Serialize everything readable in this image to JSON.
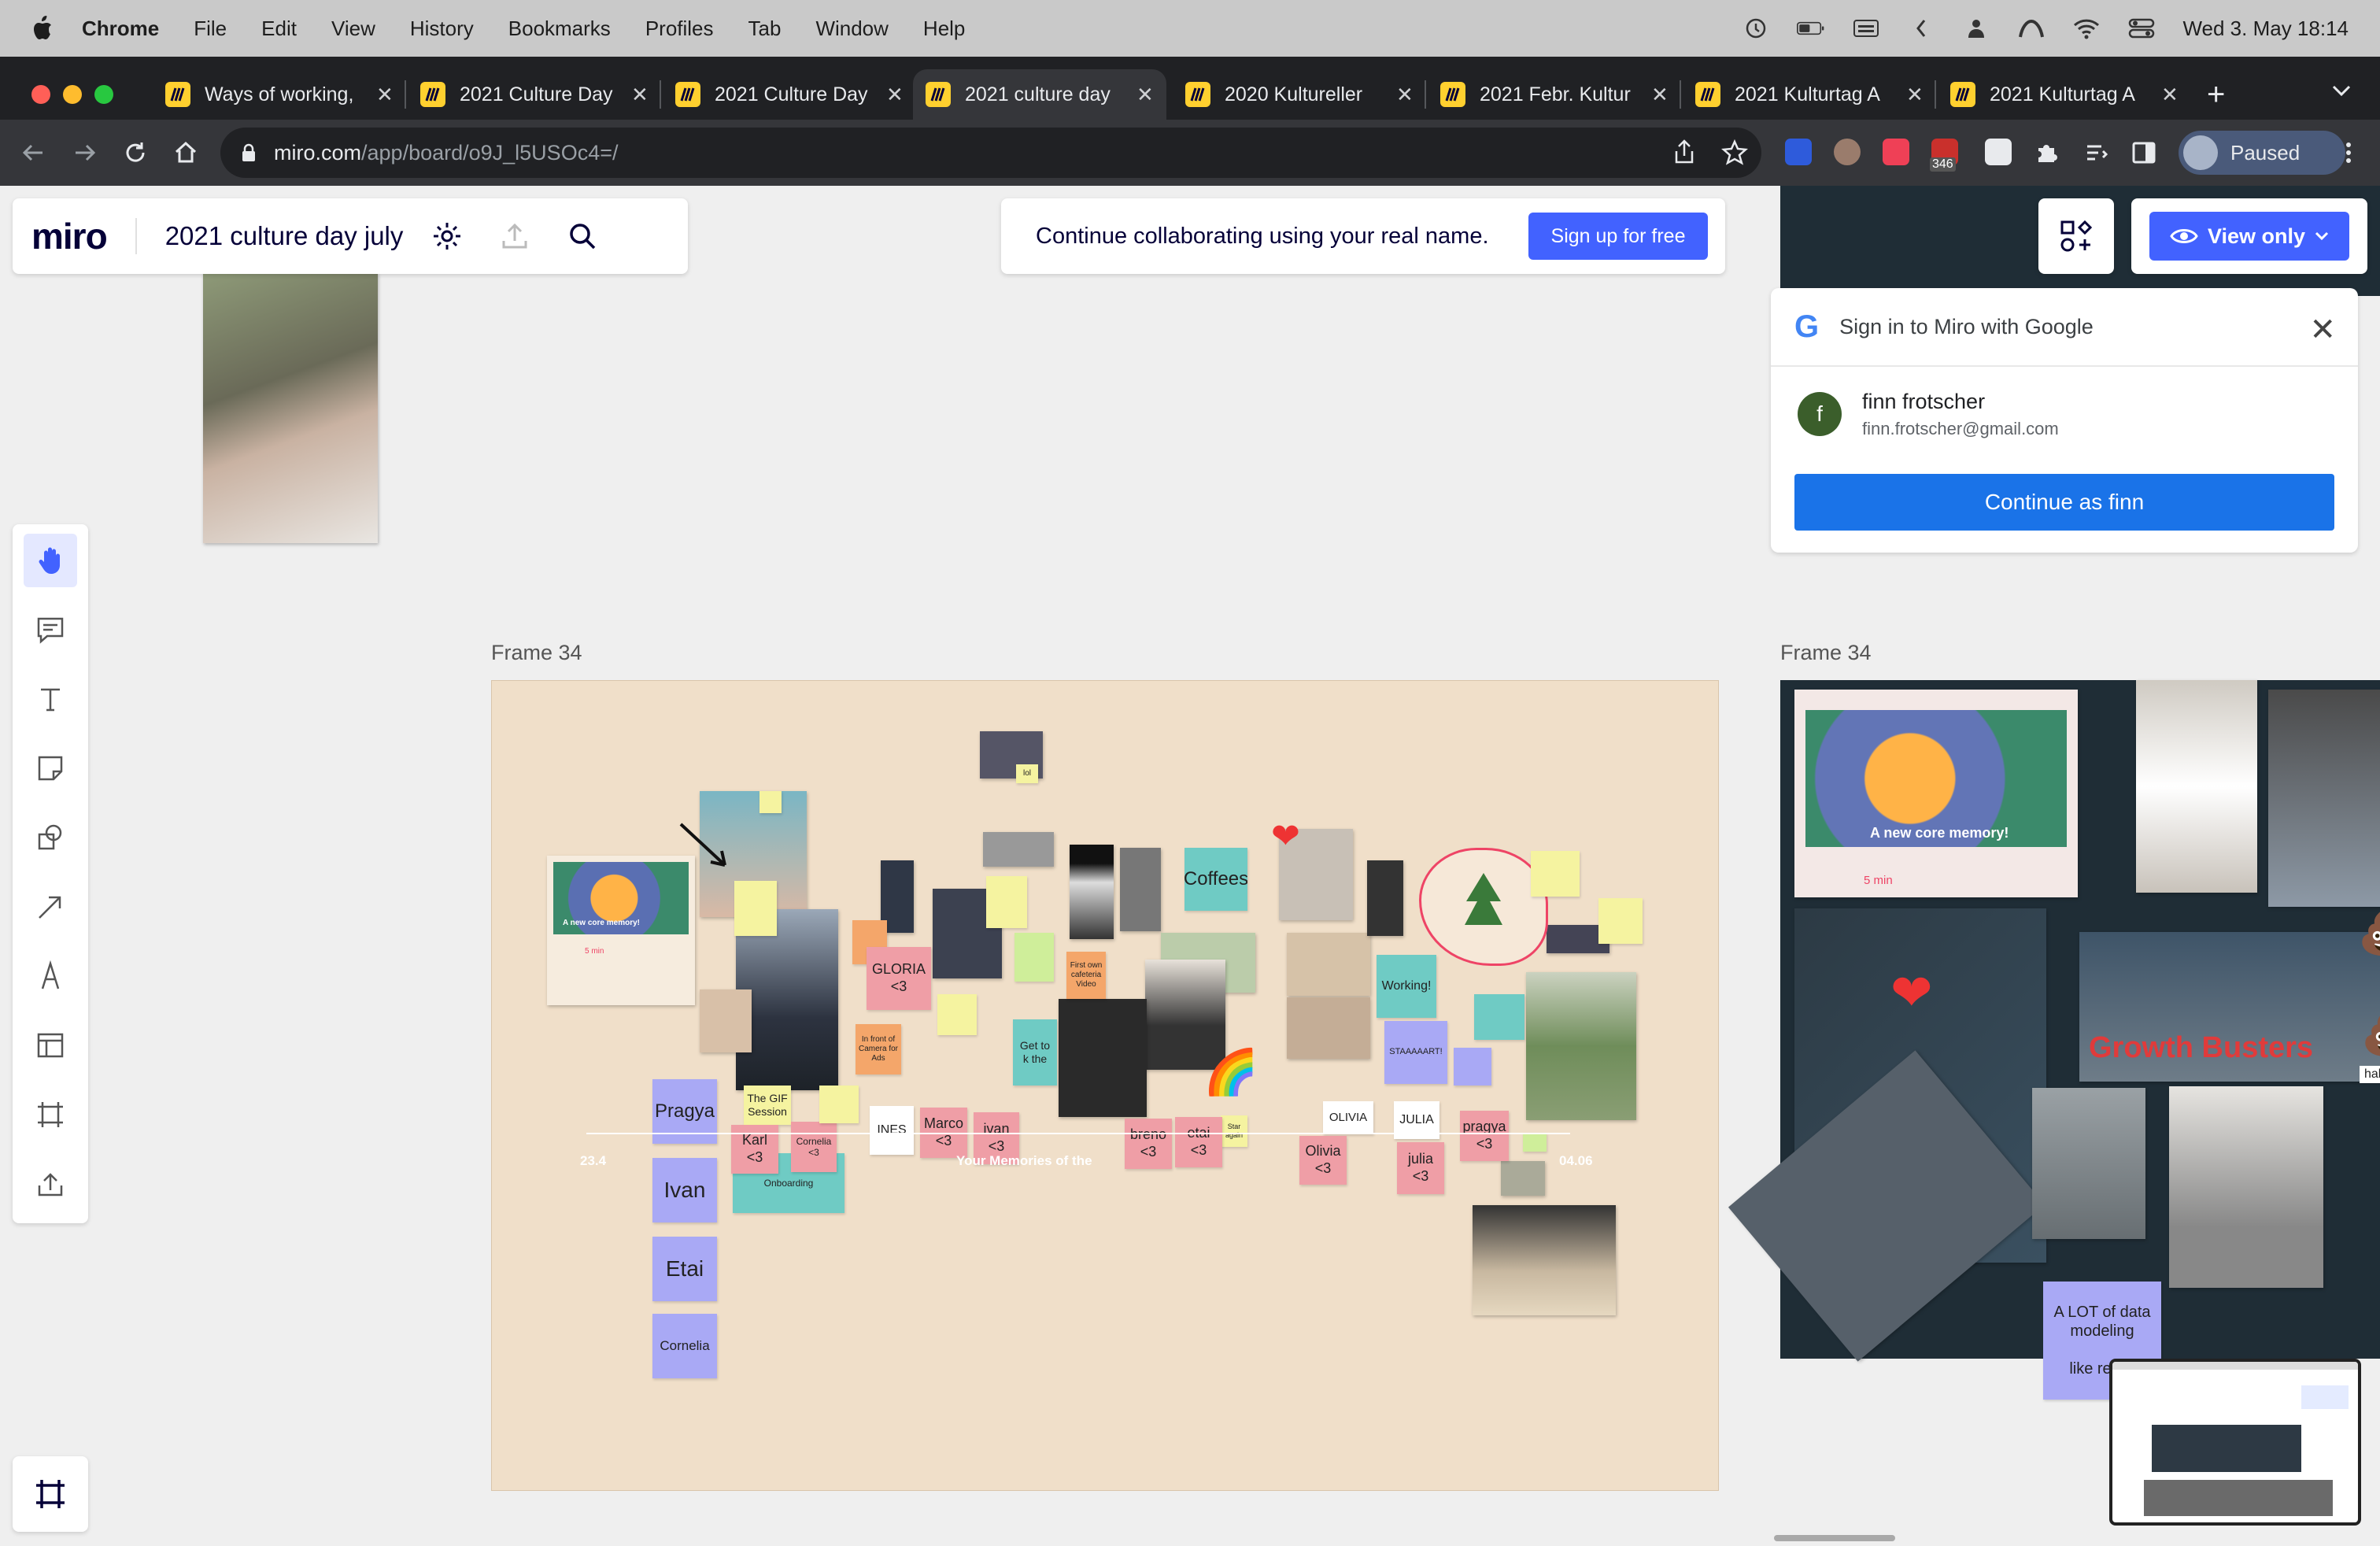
{
  "menubar": {
    "app": "Chrome",
    "items": [
      "File",
      "Edit",
      "View",
      "History",
      "Bookmarks",
      "Profiles",
      "Tab",
      "Window",
      "Help"
    ],
    "clock": "Wed 3. May  18:14"
  },
  "tabs": [
    {
      "title": "Ways of working,",
      "active": false
    },
    {
      "title": "2021 Culture Day",
      "active": false
    },
    {
      "title": "2021 Culture Day",
      "active": false
    },
    {
      "title": "2021 culture day",
      "active": true
    },
    {
      "title": "2020 Kultureller",
      "active": false
    },
    {
      "title": "2021 Febr. Kultur",
      "active": false
    },
    {
      "title": "2021 Kulturtag A",
      "active": false
    },
    {
      "title": "2021 Kulturtag A",
      "active": false
    }
  ],
  "address_bar": {
    "host": "miro.com",
    "path": "/app/board/o9J_l5USOc4=/"
  },
  "extensions": {
    "badge": "346"
  },
  "profile": {
    "label": "Paused"
  },
  "miro": {
    "logo": "miro",
    "board_name": "2021 culture day july",
    "banner_text": "Continue collaborating using your real name.",
    "signup_button": "Sign up for free",
    "view_only": "View only"
  },
  "google_signin": {
    "title": "Sign in to Miro with Google",
    "avatar_letter": "f",
    "name": "finn frotscher",
    "email": "finn.frotscher@gmail.com",
    "continue_button": "Continue as finn"
  },
  "frames": {
    "left_label": "Frame 34",
    "right_label": "Frame 34"
  },
  "left_frame": {
    "stickies": {
      "pragya": "Pragya",
      "ivan": "Ivan",
      "etai": "Etai",
      "cornelia": "Cornelia",
      "onboarding": "Onboarding",
      "gif_session": "The GIF Session",
      "karl": "Karl <3",
      "cornelia_small": "Cornelia <3",
      "ines": "INES",
      "marco": "Marco <3",
      "ivan_small": "ivan <3",
      "breno": "breno <3",
      "etai_small": "etai <3",
      "olivia_label": "OLIVIA",
      "olivia": "Olivia <3",
      "julia_label": "JULIA",
      "julia": "julia <3",
      "pragya_small": "pragya <3",
      "gloria": "GLORIA <3",
      "coffees": "Coffees",
      "working": "Working!",
      "staaaart": "STAAAAART!",
      "get_to": "Get to k the",
      "lol": "lol",
      "first_own": "First own cafeteria Video",
      "in_front": "In front of Camera for Ads",
      "star_again": "Star again",
      "memory_title": "A new core memory!",
      "memory_time": "5 min"
    },
    "timeline": {
      "start": "23.4",
      "caption": "Your Memories of the",
      "end": "04.06"
    }
  },
  "right_frame": {
    "memory_title": "A new core memory!",
    "memory_time": "5 min",
    "growth_busters": "Growth Busters",
    "haha": "haha",
    "data_sticky": "A LOT of data modeling\n\nlike really"
  },
  "colors": {
    "miro_blue": "#4262ff",
    "google_blue": "#1a73e8",
    "frame_bg": "#f0dfc9",
    "dark_frame_bg": "#1f2d36"
  }
}
